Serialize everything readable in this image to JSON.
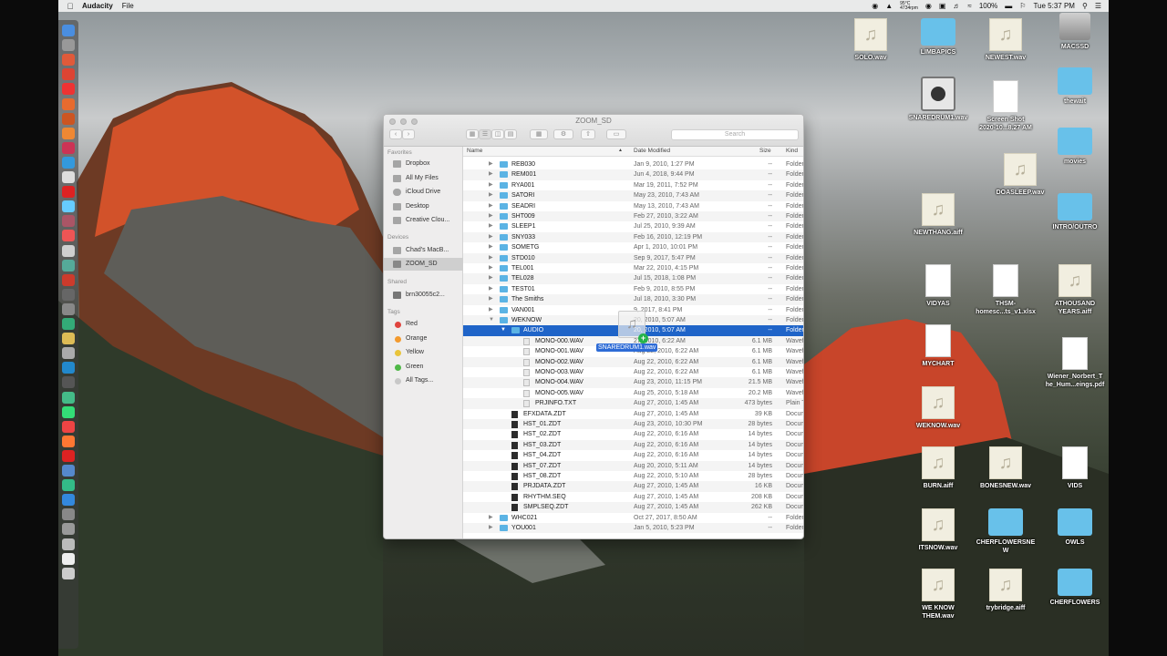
{
  "menubar": {
    "app": "Audacity",
    "file_menu": "File",
    "temp": "95°C\n4734rpm",
    "battery": "100%",
    "clock": "Tue 5:37 PM"
  },
  "finder": {
    "title": "ZOOM_SD",
    "search_placeholder": "Search",
    "sidebar": {
      "favorites_head": "Favorites",
      "favorites": [
        "Dropbox",
        "All My Files",
        "iCloud Drive",
        "Desktop",
        "Creative Clou..."
      ],
      "devices_head": "Devices",
      "devices": [
        "Chad's MacB...",
        "ZOOM_SD"
      ],
      "shared_head": "Shared",
      "shared": [
        "brn30055c2..."
      ],
      "tags_head": "Tags",
      "tags": [
        "Red",
        "Orange",
        "Yellow",
        "Green",
        "All Tags..."
      ]
    },
    "columns": {
      "name": "Name",
      "date": "Date Modified",
      "size": "Size",
      "kind": "Kind"
    },
    "rows": [
      {
        "name": "REB030",
        "date": "Jan 9, 2010, 1:27 PM",
        "size": "--",
        "kind": "Folder",
        "type": "folder",
        "indent": 0
      },
      {
        "name": "REM001",
        "date": "Jun 4, 2018, 9:44 PM",
        "size": "--",
        "kind": "Folder",
        "type": "folder",
        "indent": 0
      },
      {
        "name": "RYA001",
        "date": "Mar 19, 2011, 7:52 PM",
        "size": "--",
        "kind": "Folder",
        "type": "folder",
        "indent": 0
      },
      {
        "name": "SATORI",
        "date": "May 23, 2010, 7:43 AM",
        "size": "--",
        "kind": "Folder",
        "type": "folder",
        "indent": 0
      },
      {
        "name": "SEADRI",
        "date": "May 13, 2010, 7:43 AM",
        "size": "--",
        "kind": "Folder",
        "type": "folder",
        "indent": 0
      },
      {
        "name": "SHT009",
        "date": "Feb 27, 2010, 3:22 AM",
        "size": "--",
        "kind": "Folder",
        "type": "folder",
        "indent": 0
      },
      {
        "name": "SLEEP1",
        "date": "Jul 25, 2010, 9:39 AM",
        "size": "--",
        "kind": "Folder",
        "type": "folder",
        "indent": 0
      },
      {
        "name": "SNY033",
        "date": "Feb 16, 2010, 12:19 PM",
        "size": "--",
        "kind": "Folder",
        "type": "folder",
        "indent": 0
      },
      {
        "name": "SOMETG",
        "date": "Apr 1, 2010, 10:01 PM",
        "size": "--",
        "kind": "Folder",
        "type": "folder",
        "indent": 0
      },
      {
        "name": "STD010",
        "date": "Sep 9, 2017, 5:47 PM",
        "size": "--",
        "kind": "Folder",
        "type": "folder",
        "indent": 0
      },
      {
        "name": "TEL001",
        "date": "Mar 22, 2010, 4:15 PM",
        "size": "--",
        "kind": "Folder",
        "type": "folder",
        "indent": 0
      },
      {
        "name": "TEL028",
        "date": "Jul 15, 2018, 1:08 PM",
        "size": "--",
        "kind": "Folder",
        "type": "folder",
        "indent": 0
      },
      {
        "name": "TEST01",
        "date": "Feb 9, 2010, 8:55 PM",
        "size": "--",
        "kind": "Folder",
        "type": "folder",
        "indent": 0
      },
      {
        "name": "The Smiths",
        "date": "Jul 18, 2010, 3:30 PM",
        "size": "--",
        "kind": "Folder",
        "type": "folder",
        "indent": 0
      },
      {
        "name": "VAN001",
        "date": "9, 2017, 8:41 PM",
        "size": "--",
        "kind": "Folder",
        "type": "folder",
        "indent": 0
      },
      {
        "name": "WEKNOW",
        "date": "20, 2010, 5:07 AM",
        "size": "--",
        "kind": "Folder",
        "type": "folder",
        "indent": 0,
        "open": true
      },
      {
        "name": "AUDIO",
        "date": "20, 2010, 5:07 AM",
        "size": "--",
        "kind": "Folder",
        "type": "folder",
        "indent": 1,
        "open": true,
        "selected": true
      },
      {
        "name": "MONO-000.WAV",
        "date": "27, 2010, 6:22 AM",
        "size": "6.1 MB",
        "kind": "Waveform",
        "type": "file",
        "indent": 2
      },
      {
        "name": "MONO-001.WAV",
        "date": "Aug 22, 2010, 6:22 AM",
        "size": "6.1 MB",
        "kind": "Waveform",
        "type": "file",
        "indent": 2
      },
      {
        "name": "MONO-002.WAV",
        "date": "Aug 22, 2010, 6:22 AM",
        "size": "6.1 MB",
        "kind": "Waveform",
        "type": "file",
        "indent": 2
      },
      {
        "name": "MONO-003.WAV",
        "date": "Aug 22, 2010, 6:22 AM",
        "size": "6.1 MB",
        "kind": "Waveform",
        "type": "file",
        "indent": 2
      },
      {
        "name": "MONO-004.WAV",
        "date": "Aug 23, 2010, 11:15 PM",
        "size": "21.5 MB",
        "kind": "Waveform",
        "type": "file",
        "indent": 2
      },
      {
        "name": "MONO-005.WAV",
        "date": "Aug 25, 2010, 5:18 AM",
        "size": "20.2 MB",
        "kind": "Waveform",
        "type": "file",
        "indent": 2
      },
      {
        "name": "PRJINFO.TXT",
        "date": "Aug 27, 2010, 1:45 AM",
        "size": "473 bytes",
        "kind": "Plain Text",
        "type": "file",
        "indent": 2
      },
      {
        "name": "EFXDATA.ZDT",
        "date": "Aug 27, 2010, 1:45 AM",
        "size": "39 KB",
        "kind": "Document",
        "type": "doc",
        "indent": 1
      },
      {
        "name": "HST_01.ZDT",
        "date": "Aug 23, 2010, 10:30 PM",
        "size": "28 bytes",
        "kind": "Document",
        "type": "doc",
        "indent": 1
      },
      {
        "name": "HST_02.ZDT",
        "date": "Aug 22, 2010, 6:16 AM",
        "size": "14 bytes",
        "kind": "Document",
        "type": "doc",
        "indent": 1
      },
      {
        "name": "HST_03.ZDT",
        "date": "Aug 22, 2010, 6:16 AM",
        "size": "14 bytes",
        "kind": "Document",
        "type": "doc",
        "indent": 1
      },
      {
        "name": "HST_04.ZDT",
        "date": "Aug 22, 2010, 6:16 AM",
        "size": "14 bytes",
        "kind": "Document",
        "type": "doc",
        "indent": 1
      },
      {
        "name": "HST_07.ZDT",
        "date": "Aug 20, 2010, 5:11 AM",
        "size": "14 bytes",
        "kind": "Document",
        "type": "doc",
        "indent": 1
      },
      {
        "name": "HST_08.ZDT",
        "date": "Aug 22, 2010, 5:10 AM",
        "size": "28 bytes",
        "kind": "Document",
        "type": "doc",
        "indent": 1
      },
      {
        "name": "PRJDATA.ZDT",
        "date": "Aug 27, 2010, 1:45 AM",
        "size": "16 KB",
        "kind": "Document",
        "type": "doc",
        "indent": 1
      },
      {
        "name": "RHYTHM.SEQ",
        "date": "Aug 27, 2010, 1:45 AM",
        "size": "208 KB",
        "kind": "Document",
        "type": "doc",
        "indent": 1
      },
      {
        "name": "SMPLSEQ.ZDT",
        "date": "Aug 27, 2010, 1:45 AM",
        "size": "262 KB",
        "kind": "Document",
        "type": "doc",
        "indent": 1
      },
      {
        "name": "WHC021",
        "date": "Oct 27, 2017, 8:50 AM",
        "size": "--",
        "kind": "Folder",
        "type": "folder",
        "indent": 0
      },
      {
        "name": "YOU001",
        "date": "Jan 5, 2010, 5:23 PM",
        "size": "--",
        "kind": "Folder",
        "type": "folder",
        "indent": 0
      }
    ],
    "drag_label": "SNAREDRUM1.wav",
    "drag_plus": "+"
  },
  "desktop_icons": [
    {
      "label": "SOLO.wav",
      "kind": "audio"
    },
    {
      "label": "LIMBAPICS",
      "kind": "folder"
    },
    {
      "label": "NEWEST.wav",
      "kind": "audio"
    },
    {
      "label": "MACSSD",
      "kind": "disk"
    },
    {
      "label": "SNAREDRUM1.wav",
      "kind": "video"
    },
    {
      "label": "Screen Shot\n2020-10...8.27 AM",
      "kind": "doc"
    },
    {
      "label": "thewait",
      "kind": "folder"
    },
    {
      "label": "movies",
      "kind": "folder"
    },
    {
      "label": "DOASLEEP.wav",
      "kind": "audio"
    },
    {
      "label": "NEWTHANG.aiff",
      "kind": "audio"
    },
    {
      "label": "INTRO/OUTRO",
      "kind": "folder"
    },
    {
      "label": "VIDYAS",
      "kind": "doc"
    },
    {
      "label": "THSM-\nhomesc...ts_v1.xlsx",
      "kind": "doc"
    },
    {
      "label": "ATHOUSAND\nYEARS.aiff",
      "kind": "audio"
    },
    {
      "label": "MYCHART",
      "kind": "doc"
    },
    {
      "label": "Wiener_Norbert_T\nhe_Hum...eings.pdf",
      "kind": "doc"
    },
    {
      "label": "WEKNOW.wav",
      "kind": "audio"
    },
    {
      "label": "BURN.aiff",
      "kind": "audio"
    },
    {
      "label": "BONESNEW.wav",
      "kind": "audio"
    },
    {
      "label": "VIDS",
      "kind": "doc"
    },
    {
      "label": "ITSNOW.wav",
      "kind": "audio"
    },
    {
      "label": "CHERFLOWERSNE\nW",
      "kind": "folder"
    },
    {
      "label": "OWLS",
      "kind": "folder"
    },
    {
      "label": "WE KNOW\nTHEM.wav",
      "kind": "audio"
    },
    {
      "label": "trybridge.aiff",
      "kind": "audio"
    },
    {
      "label": "CHERFLOWERS",
      "kind": "folder"
    }
  ],
  "colors": {
    "selection": "#1f64c8",
    "folder": "#5bb3e4",
    "tag_red": "#e0443e",
    "tag_orange": "#f39a2e",
    "tag_yellow": "#e9c43a",
    "tag_green": "#4fb847",
    "tag_all": "#c8c8c8"
  }
}
